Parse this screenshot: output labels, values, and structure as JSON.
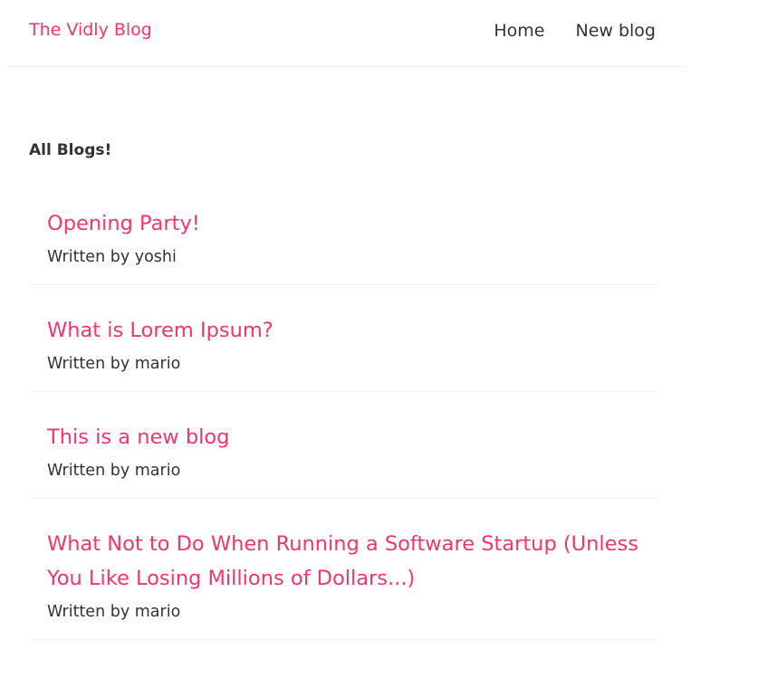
{
  "navbar": {
    "brand": "The Vidly Blog",
    "links": [
      {
        "label": "Home"
      },
      {
        "label": "New blog"
      }
    ]
  },
  "main": {
    "heading": "All Blogs!",
    "blogs": [
      {
        "title": "Opening Party!",
        "author": "Written by yoshi"
      },
      {
        "title": "What is Lorem Ipsum?",
        "author": "Written by mario"
      },
      {
        "title": "This is a new blog",
        "author": "Written by mario"
      },
      {
        "title": "What Not to Do When Running a Software Startup (Unless You Like Losing Millions of Dollars...)",
        "author": "Written by mario"
      }
    ]
  },
  "colors": {
    "accent": "#f1356d",
    "text": "#333333",
    "divider": "#f4f4f4"
  }
}
